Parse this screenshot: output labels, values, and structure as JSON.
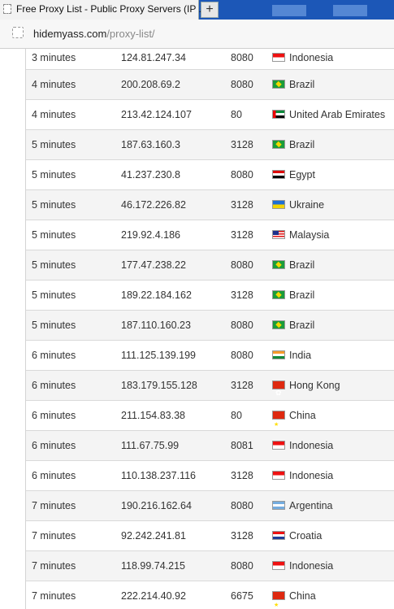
{
  "browser": {
    "tab_title": "Free Proxy List - Public Proxy Servers (IP ...",
    "new_tab_label": "+",
    "url_host": "hidemyass.com",
    "url_path": "/proxy-list/"
  },
  "rows": [
    {
      "time": "3 minutes",
      "ip": "124.81.247.34",
      "port": "8080",
      "country": "Indonesia",
      "flag": "indonesia"
    },
    {
      "time": "4 minutes",
      "ip": "200.208.69.2",
      "port": "8080",
      "country": "Brazil",
      "flag": "brazil"
    },
    {
      "time": "4 minutes",
      "ip": "213.42.124.107",
      "port": "80",
      "country": "United Arab Emirates",
      "flag": "uae"
    },
    {
      "time": "5 minutes",
      "ip": "187.63.160.3",
      "port": "3128",
      "country": "Brazil",
      "flag": "brazil"
    },
    {
      "time": "5 minutes",
      "ip": "41.237.230.8",
      "port": "8080",
      "country": "Egypt",
      "flag": "egypt"
    },
    {
      "time": "5 minutes",
      "ip": "46.172.226.82",
      "port": "3128",
      "country": "Ukraine",
      "flag": "ukraine"
    },
    {
      "time": "5 minutes",
      "ip": "219.92.4.186",
      "port": "3128",
      "country": "Malaysia",
      "flag": "malaysia"
    },
    {
      "time": "5 minutes",
      "ip": "177.47.238.22",
      "port": "8080",
      "country": "Brazil",
      "flag": "brazil"
    },
    {
      "time": "5 minutes",
      "ip": "189.22.184.162",
      "port": "3128",
      "country": "Brazil",
      "flag": "brazil"
    },
    {
      "time": "5 minutes",
      "ip": "187.110.160.23",
      "port": "8080",
      "country": "Brazil",
      "flag": "brazil"
    },
    {
      "time": "6 minutes",
      "ip": "111.125.139.199",
      "port": "8080",
      "country": "India",
      "flag": "india"
    },
    {
      "time": "6 minutes",
      "ip": "183.179.155.128",
      "port": "3128",
      "country": "Hong Kong",
      "flag": "hongkong"
    },
    {
      "time": "6 minutes",
      "ip": "211.154.83.38",
      "port": "80",
      "country": "China",
      "flag": "china"
    },
    {
      "time": "6 minutes",
      "ip": "111.67.75.99",
      "port": "8081",
      "country": "Indonesia",
      "flag": "indonesia"
    },
    {
      "time": "6 minutes",
      "ip": "110.138.237.116",
      "port": "3128",
      "country": "Indonesia",
      "flag": "indonesia"
    },
    {
      "time": "7 minutes",
      "ip": "190.216.162.64",
      "port": "8080",
      "country": "Argentina",
      "flag": "argentina"
    },
    {
      "time": "7 minutes",
      "ip": "92.242.241.81",
      "port": "3128",
      "country": "Croatia",
      "flag": "croatia"
    },
    {
      "time": "7 minutes",
      "ip": "118.99.74.215",
      "port": "8080",
      "country": "Indonesia",
      "flag": "indonesia"
    },
    {
      "time": "7 minutes",
      "ip": "222.214.40.92",
      "port": "6675",
      "country": "China",
      "flag": "china"
    }
  ]
}
